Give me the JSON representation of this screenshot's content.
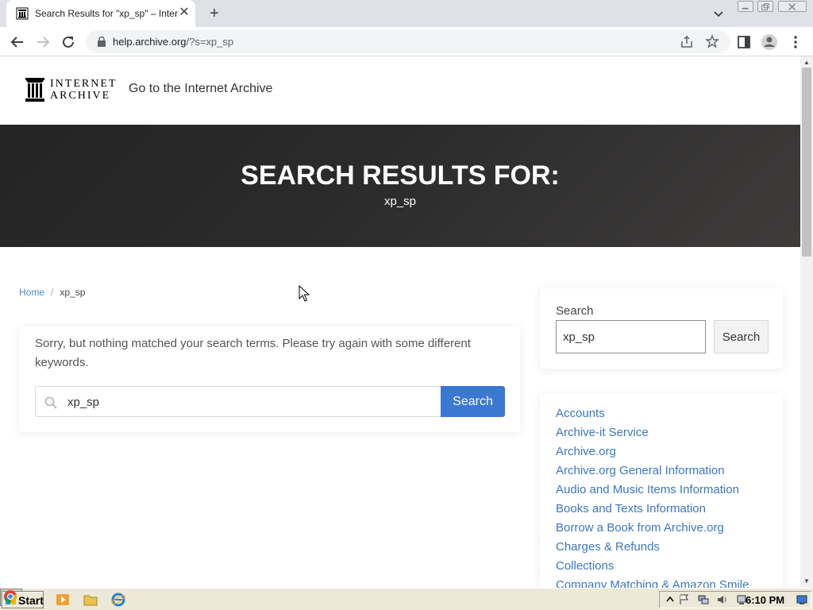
{
  "browser": {
    "tab_title": "Search Results for \"xp_sp\" – Inter",
    "url_host": "help.archive.org",
    "url_path": "/?s=xp_sp"
  },
  "site_header": {
    "logo_line1": "INTERNET",
    "logo_line2": "ARCHIVE",
    "goto_link": "Go to the Internet Archive"
  },
  "hero": {
    "title": "SEARCH RESULTS FOR:",
    "term": "xp_sp"
  },
  "breadcrumb": {
    "home": "Home",
    "separator": "/",
    "current": "xp_sp"
  },
  "main": {
    "message": "Sorry, but nothing matched your search terms. Please try again with some different keywords.",
    "search_value": "xp_sp",
    "search_button": "Search"
  },
  "sidebar": {
    "search_label": "Search",
    "search_value": "xp_sp",
    "search_button": "Search",
    "categories": [
      "Accounts",
      "Archive-it Service",
      "Archive.org",
      "Archive.org General Information",
      "Audio and Music Items Information",
      "Books and Texts Information",
      "Borrow a Book from Archive.org",
      "Charges & Refunds",
      "Collections",
      "Company Matching & Amazon Smile"
    ]
  },
  "taskbar": {
    "start_label": "Start",
    "clock": "6:10 PM"
  },
  "colors": {
    "link": "#3b76c4",
    "primary_button": "#3a78d2",
    "hero_bg": "#2b2b2b"
  }
}
